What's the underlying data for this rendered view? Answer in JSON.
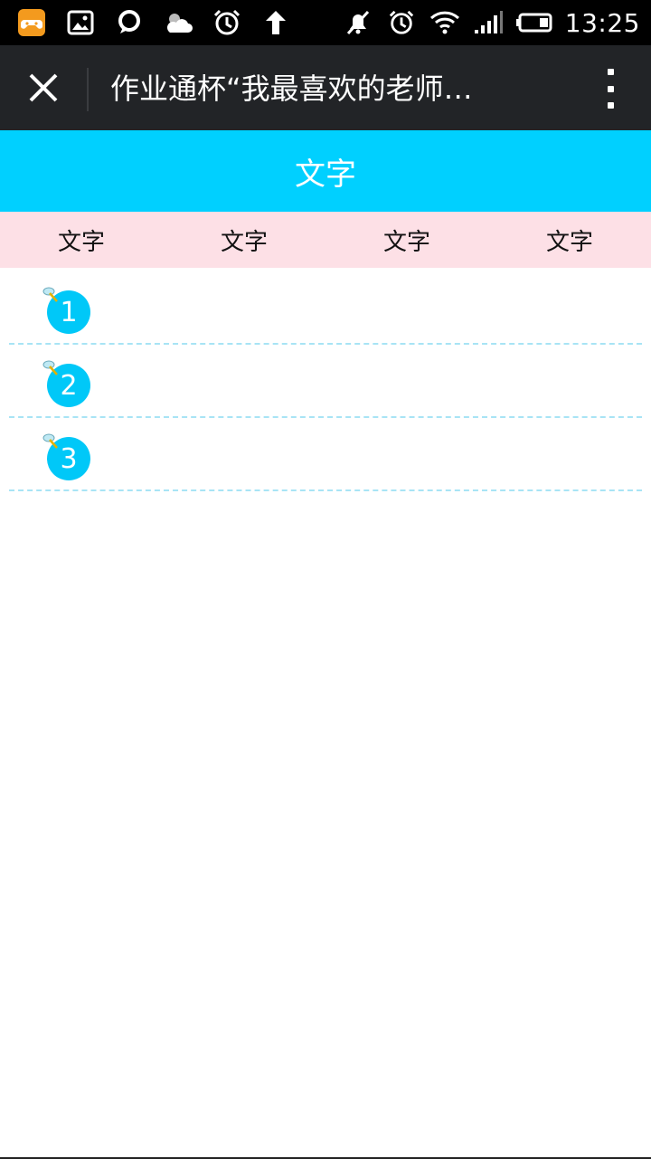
{
  "status_bar": {
    "time": "13:25",
    "left_icons": [
      "game-app-icon",
      "gallery-icon",
      "chat-icon",
      "weather-icon",
      "alarm-icon",
      "upload-arrow-icon"
    ],
    "right_icons": [
      "mute-icon",
      "alarm-icon",
      "wifi-icon",
      "signal-icon",
      "battery-icon"
    ]
  },
  "titlebar": {
    "title": "作业通杯“我最喜欢的老师…"
  },
  "header": {
    "title": "文字"
  },
  "tabs": [
    {
      "label": "文字"
    },
    {
      "label": "文字"
    },
    {
      "label": "文字"
    },
    {
      "label": "文字"
    }
  ],
  "list": [
    {
      "number": "1"
    },
    {
      "number": "2"
    },
    {
      "number": "3"
    }
  ],
  "colors": {
    "header": "#00d0ff",
    "tabs_bg": "#fde0e6",
    "badge": "#00c8f8",
    "titlebar": "#222427"
  }
}
